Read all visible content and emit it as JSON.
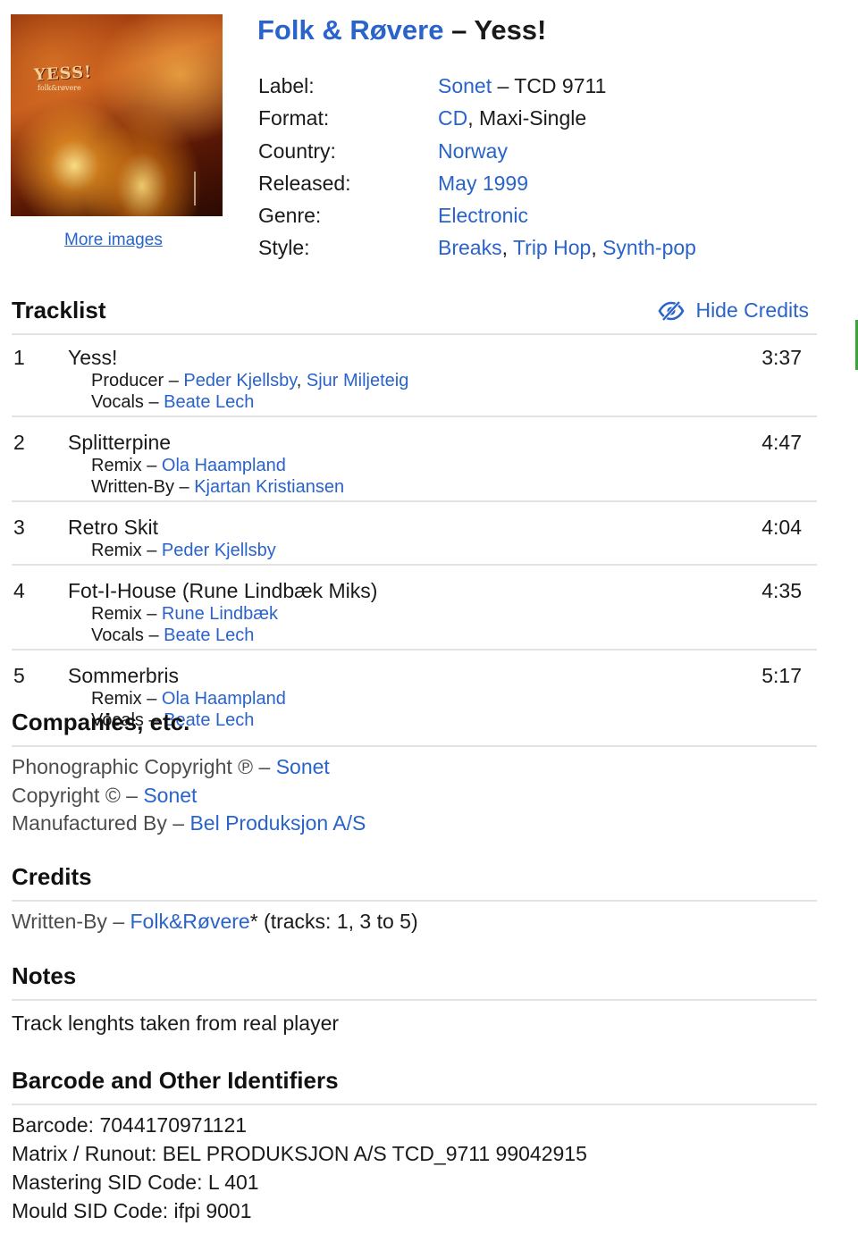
{
  "header": {
    "artist": "Folk & Røvere",
    "dash": " – ",
    "title": "Yess!",
    "cover": {
      "title": "YESS!",
      "subtitle": "folk&røvere"
    },
    "more_images": "More images"
  },
  "info": [
    {
      "key": "Label:",
      "parts": [
        {
          "text": "Sonet",
          "link": true
        },
        {
          "text": " – TCD 9711",
          "link": false
        }
      ]
    },
    {
      "key": "Format:",
      "parts": [
        {
          "text": "CD",
          "link": true
        },
        {
          "text": ", Maxi-Single",
          "link": false
        }
      ]
    },
    {
      "key": "Country:",
      "parts": [
        {
          "text": "Norway",
          "link": true
        }
      ]
    },
    {
      "key": "Released:",
      "parts": [
        {
          "text": "May 1999",
          "link": true
        }
      ]
    },
    {
      "key": "Genre:",
      "parts": [
        {
          "text": "Electronic",
          "link": true
        }
      ]
    },
    {
      "key": "Style:",
      "parts": [
        {
          "text": "Breaks",
          "link": true
        },
        {
          "text": ", ",
          "link": false
        },
        {
          "text": "Trip Hop",
          "link": true
        },
        {
          "text": ", ",
          "link": false
        },
        {
          "text": "Synth-pop",
          "link": true
        }
      ]
    }
  ],
  "tracklist": {
    "heading": "Tracklist",
    "hide_credits": "Hide Credits",
    "tracks": [
      {
        "pos": "1",
        "title": "Yess!",
        "duration": "3:37",
        "credits": [
          {
            "role": "Producer – ",
            "names": [
              {
                "text": "Peder Kjellsby",
                "link": true
              },
              {
                "text": ", ",
                "link": false
              },
              {
                "text": "Sjur Miljeteig",
                "link": true
              }
            ]
          },
          {
            "role": "Vocals – ",
            "names": [
              {
                "text": "Beate Lech",
                "link": true
              }
            ]
          }
        ]
      },
      {
        "pos": "2",
        "title": "Splitterpine",
        "duration": "4:47",
        "credits": [
          {
            "role": "Remix – ",
            "names": [
              {
                "text": "Ola Haampland",
                "link": true
              }
            ]
          },
          {
            "role": "Written-By – ",
            "names": [
              {
                "text": "Kjartan Kristiansen",
                "link": true
              }
            ]
          }
        ]
      },
      {
        "pos": "3",
        "title": "Retro Skit",
        "duration": "4:04",
        "credits": [
          {
            "role": "Remix – ",
            "names": [
              {
                "text": "Peder Kjellsby",
                "link": true
              }
            ]
          }
        ]
      },
      {
        "pos": "4",
        "title": "Fot-I-House (Rune Lindbæk Miks)",
        "duration": "4:35",
        "credits": [
          {
            "role": "Remix – ",
            "names": [
              {
                "text": "Rune Lindbæk",
                "link": true
              }
            ]
          },
          {
            "role": "Vocals – ",
            "names": [
              {
                "text": "Beate Lech",
                "link": true
              }
            ]
          }
        ]
      },
      {
        "pos": "5",
        "title": "Sommerbris",
        "duration": "5:17",
        "credits": [
          {
            "role": "Remix – ",
            "names": [
              {
                "text": "Ola Haampland",
                "link": true
              }
            ]
          },
          {
            "role": "Vocals – ",
            "names": [
              {
                "text": "Beate Lech",
                "link": true
              }
            ]
          }
        ]
      }
    ]
  },
  "companies": {
    "heading": "Companies, etc.",
    "items": [
      {
        "role": "Phonographic Copyright ℗ – ",
        "name": "Sonet"
      },
      {
        "role": "Copyright © – ",
        "name": "Sonet"
      },
      {
        "role": "Manufactured By – ",
        "name": "Bel Produksjon A/S"
      }
    ]
  },
  "credits": {
    "heading": "Credits",
    "role": "Written-By – ",
    "name": "Folk&Røvere",
    "suffix": "* (tracks: 1, 3 to 5)"
  },
  "notes": {
    "heading": "Notes",
    "text": "Track lenghts taken from real player"
  },
  "identifiers": {
    "heading": "Barcode and Other Identifiers",
    "items": [
      "Barcode: 7044170971121",
      "Matrix / Runout: BEL PRODUKSJON A/S TCD_9711 99042915",
      "Mastering SID Code: L 401",
      "Mould SID Code: ifpi 9001"
    ]
  },
  "colors": {
    "link": "#2a63c9",
    "text": "#1a1a1a",
    "muted": "#4d4d4d",
    "rule": "#e3e3e3"
  }
}
